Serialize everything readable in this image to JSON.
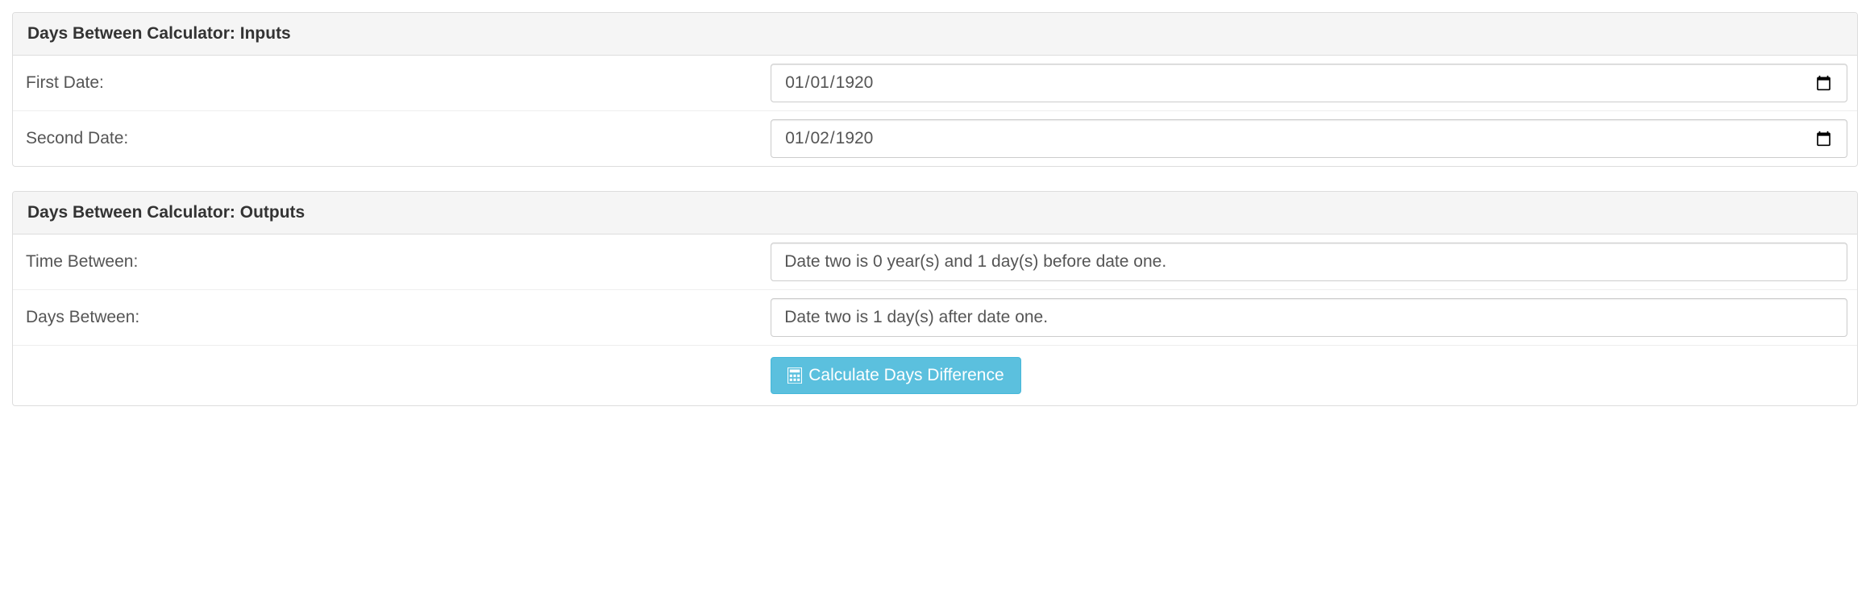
{
  "inputs": {
    "heading": "Days Between Calculator: Inputs",
    "first_date_label": "First Date:",
    "first_date_value": "1920-01-01",
    "second_date_label": "Second Date:",
    "second_date_value": "1920-01-02"
  },
  "outputs": {
    "heading": "Days Between Calculator: Outputs",
    "time_between_label": "Time Between:",
    "time_between_value": "Date two is 0 year(s) and 1 day(s) before date one.",
    "days_between_label": "Days Between:",
    "days_between_value": "Date two is 1 day(s) after date one.",
    "calculate_button_label": "Calculate Days Difference"
  },
  "colors": {
    "button_bg": "#5bc0de",
    "panel_header_bg": "#f5f5f5",
    "border": "#ddd"
  }
}
